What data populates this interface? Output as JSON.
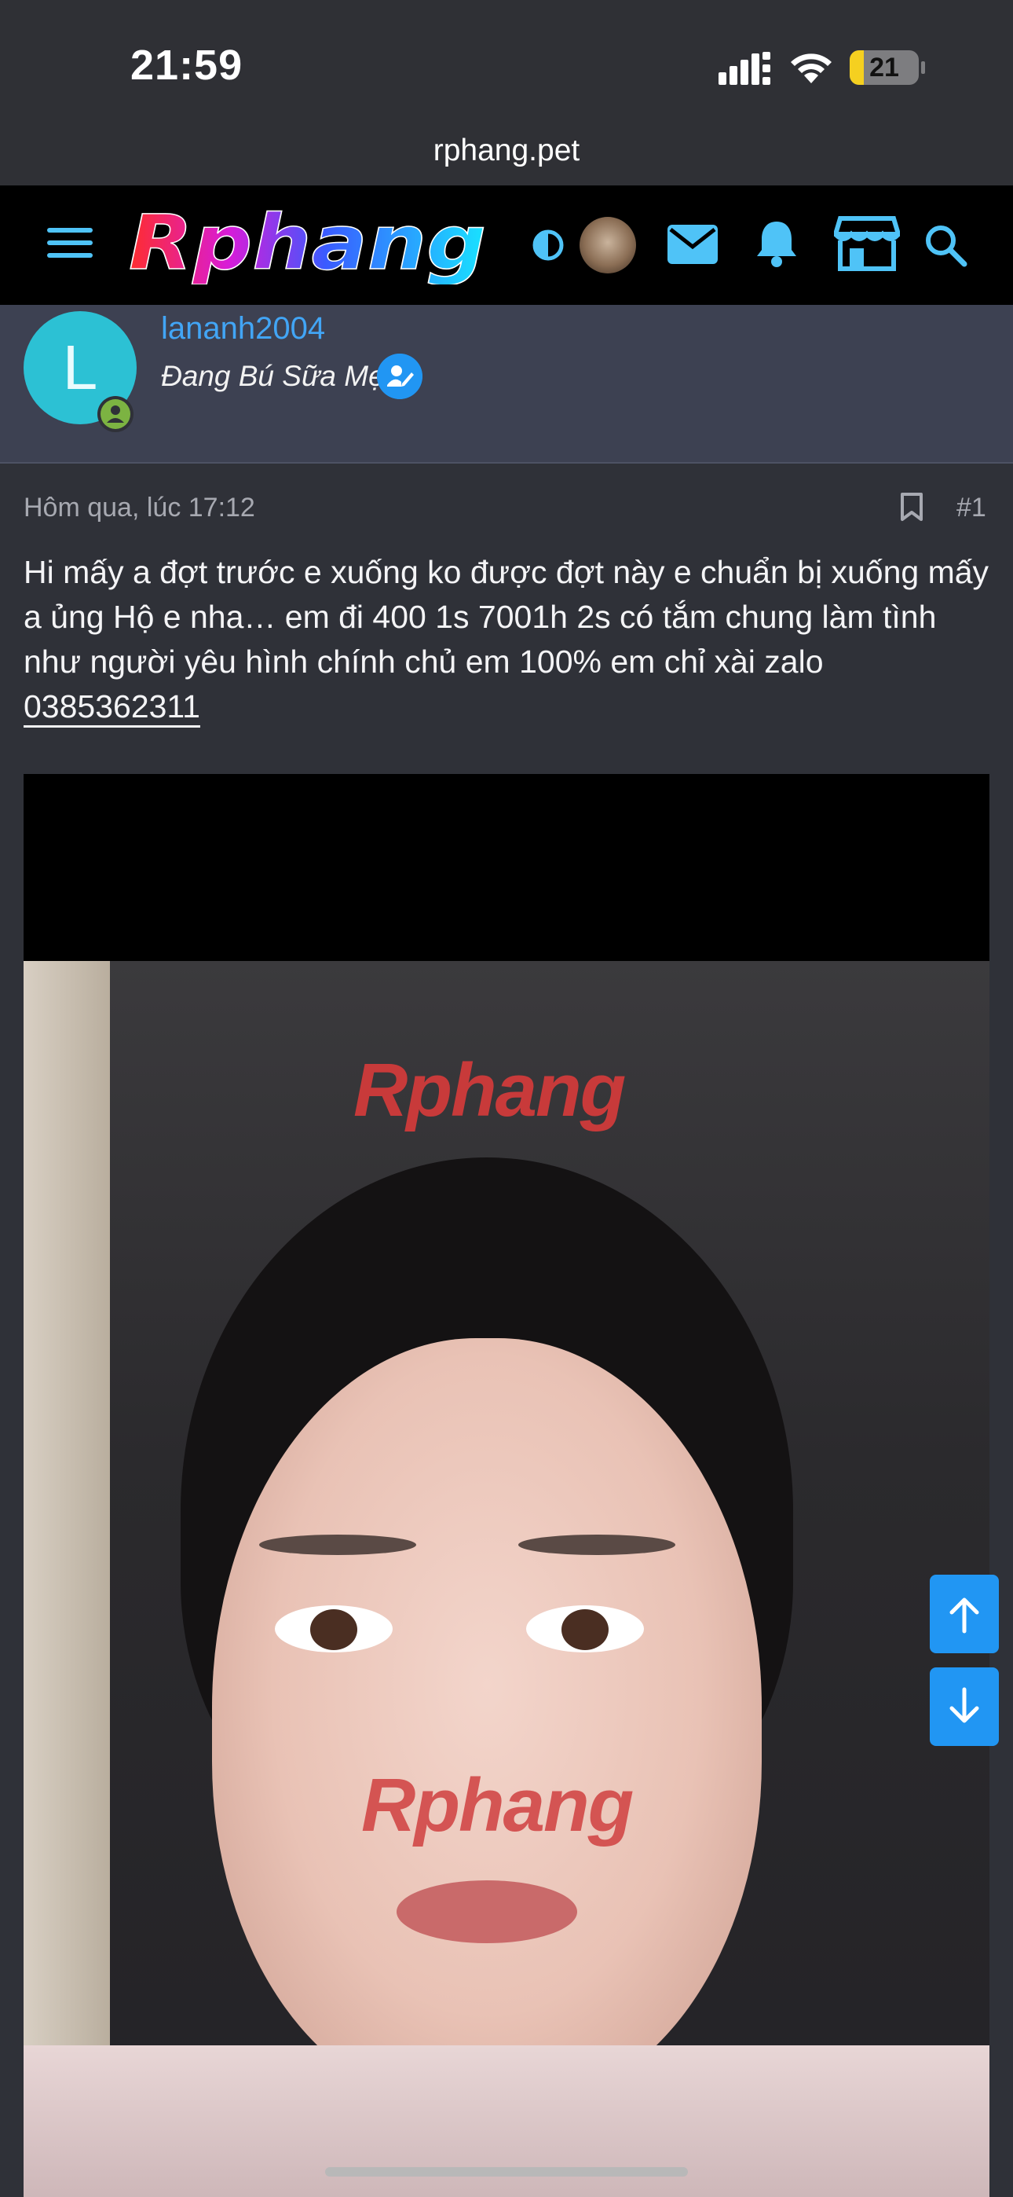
{
  "status_bar": {
    "time": "21:59",
    "battery": "21",
    "battery_level": 0.21,
    "battery_color": "#f5d020"
  },
  "browser": {
    "url": "rphang.pet"
  },
  "header": {
    "logo_text": "Rphang",
    "icons": [
      "menu-icon",
      "theme-toggle-icon",
      "user-avatar",
      "mail-icon",
      "bell-icon",
      "store-icon",
      "search-icon"
    ],
    "accent": "#4fc3f7"
  },
  "author": {
    "avatar_letter": "L",
    "avatar_color": "#2cc1d4",
    "username": "lananh2004",
    "title": "Đang Bú Sữa Mẹ"
  },
  "post": {
    "date": "Hôm qua, lúc 17:12",
    "number": "#1",
    "body_text": "Hi mấy a đợt trước e xuống ko được đợt này e chuẩn bị xuống mấy a ủng Hộ e nha… em đi 400 1s 7001h 2s có tắm chung làm tình như người yêu hình chính chủ em 100% em chỉ xài zalo",
    "phone": "0385362311"
  },
  "image": {
    "watermark_1": "Rphang",
    "watermark_2": "Rphang"
  },
  "scroll": {
    "up_icon": "arrow-up-icon",
    "down_icon": "arrow-down-icon"
  }
}
